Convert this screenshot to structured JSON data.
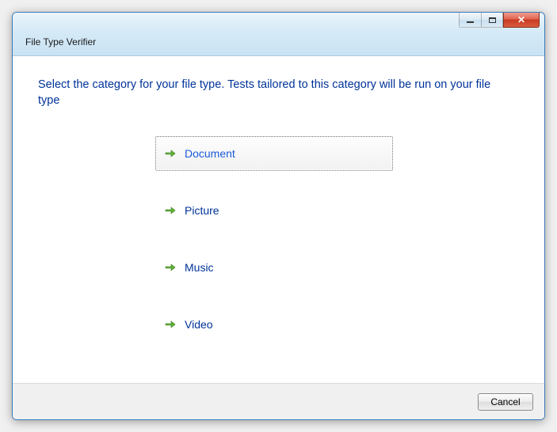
{
  "window": {
    "title": "File Type Verifier"
  },
  "instruction": "Select the category for your file type.  Tests tailored to this category will be run on your file type",
  "options": [
    {
      "label": "Document",
      "focused": true
    },
    {
      "label": "Picture",
      "focused": false
    },
    {
      "label": "Music",
      "focused": false
    },
    {
      "label": "Video",
      "focused": false
    }
  ],
  "footer": {
    "cancel": "Cancel"
  }
}
